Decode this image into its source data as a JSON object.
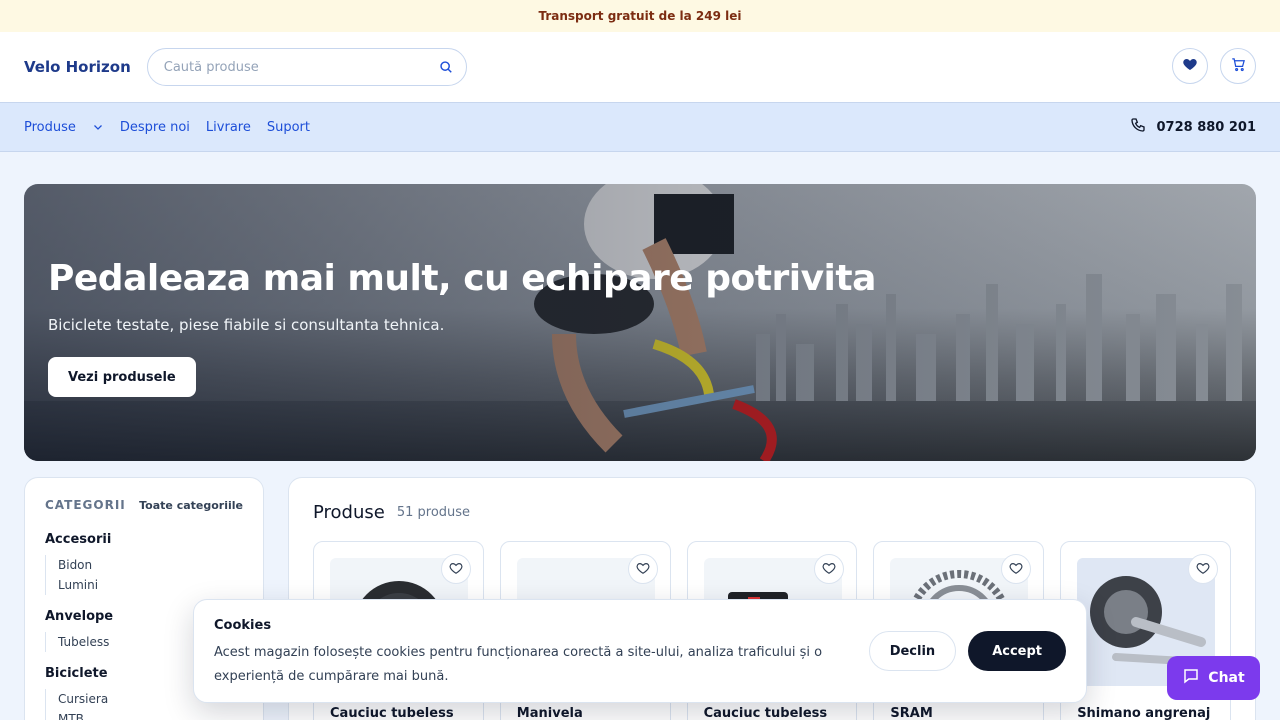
{
  "topbar": {
    "text": "Transport gratuit de la 249 lei"
  },
  "header": {
    "logo": "Velo Horizon",
    "search_placeholder": "Caută produse",
    "icons": [
      "heart-icon",
      "cart-icon"
    ]
  },
  "nav": {
    "items": [
      "Produse",
      "Despre noi",
      "Livrare",
      "Suport"
    ],
    "phone": "0728 880 201"
  },
  "hero": {
    "title": "Pedaleaza mai mult, cu echipare potrivita",
    "subtitle": "Biciclete testate, piese fiabile si consultanta tehnica.",
    "cta": "Vezi produsele"
  },
  "sidebar": {
    "title": "CATEGORII",
    "all_link": "Toate categoriile",
    "categories": [
      {
        "name": "Accesorii",
        "subs": [
          "Bidon",
          "Lumini"
        ]
      },
      {
        "name": "Anvelope",
        "subs": [
          "Tubeless"
        ]
      },
      {
        "name": "Biciclete",
        "subs": [
          "Cursiera",
          "MTB"
        ]
      }
    ]
  },
  "products": {
    "title": "Produse",
    "count": "51 produse",
    "items": [
      {
        "name": "Cauciuc tubeless"
      },
      {
        "name": "Manivela"
      },
      {
        "name": "Cauciuc tubeless"
      },
      {
        "name": "SRAM"
      },
      {
        "name": "Shimano angrenaj"
      }
    ]
  },
  "cookie": {
    "title": "Cookies",
    "text": "Acest magazin folosește cookies pentru funcționarea corectă a site-ului, analiza traficului și o experiență de cumpărare mai bună.",
    "decline": "Declin",
    "accept": "Accept"
  },
  "chat": {
    "label": "Chat"
  },
  "colors": {
    "brand": "#1e3a8a",
    "accent": "#7c3aed",
    "nav_bg": "#dbe8fc",
    "topbar_bg": "#fef9e3"
  }
}
